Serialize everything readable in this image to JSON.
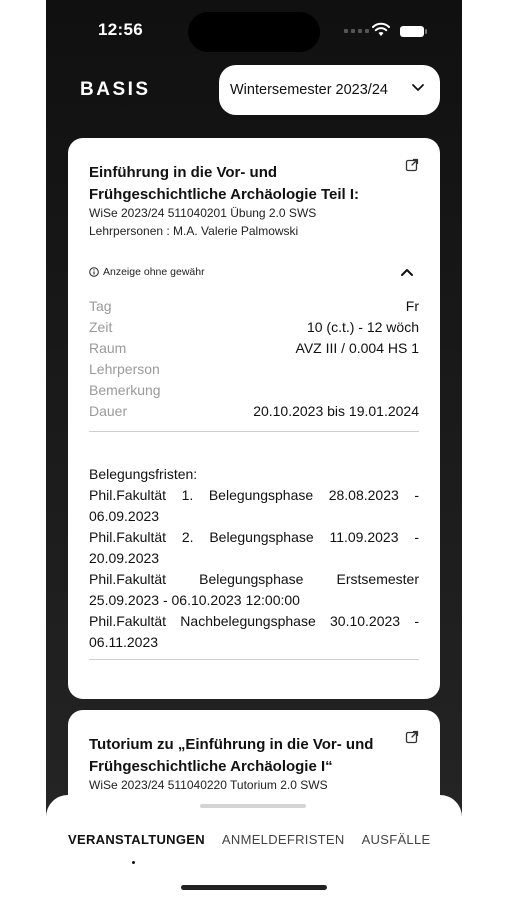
{
  "status": {
    "time": "12:56"
  },
  "header": {
    "brand": "BASIS",
    "semester": "Wintersemester 2023/24"
  },
  "course1": {
    "title": "Einführung in die Vor- und Frühgeschichtliche Archäologie Teil I:",
    "meta": "WiSe 2023/24 511040201 Übung 2.0 SWS",
    "lecturers": "Lehrpersonen : M.A. Valerie Palmowski",
    "disclaimer": "Anzeige ohne gewähr",
    "details": [
      {
        "label": "Tag",
        "value": "Fr"
      },
      {
        "label": "Zeit",
        "value": "10 (c.t.) - 12 wöch"
      },
      {
        "label": "Raum",
        "value": "AVZ III / 0.004 HS 1"
      },
      {
        "label": "Lehrperson",
        "value": ""
      },
      {
        "label": "Bemerkung",
        "value": ""
      },
      {
        "label": "Dauer",
        "value": "20.10.2023 bis 19.01.2024"
      }
    ],
    "fristen_title": "Belegungsfristen:",
    "fristen": [
      "Phil.Fakultät 1. Belegungsphase 28.08.2023 - 06.09.2023",
      "Phil.Fakultät 2. Belegungsphase 11.09.2023 - 20.09.2023",
      "Phil.Fakultät Belegungsphase Erstsemester 25.09.2023 - 06.10.2023 12:00:00",
      "Phil.Fakultät Nachbelegungsphase 30.10.2023 - 06.11.2023"
    ]
  },
  "course2": {
    "title": "Tutorium zu „Einführung in die Vor- und Frühgeschichtliche Archäologie I“",
    "meta": "WiSe 2023/24 511040220 Tutorium 2.0 SWS"
  },
  "tabs": [
    {
      "label": "VERANSTALTUNGEN",
      "active": true
    },
    {
      "label": "ANMELDEFRISTEN",
      "active": false
    },
    {
      "label": "AUSFÄLLE",
      "active": false
    }
  ],
  "icons": {
    "external": "external-link-icon",
    "chevron": "chevron-down-icon",
    "collapse": "chevron-up-icon",
    "info": "info-icon"
  }
}
